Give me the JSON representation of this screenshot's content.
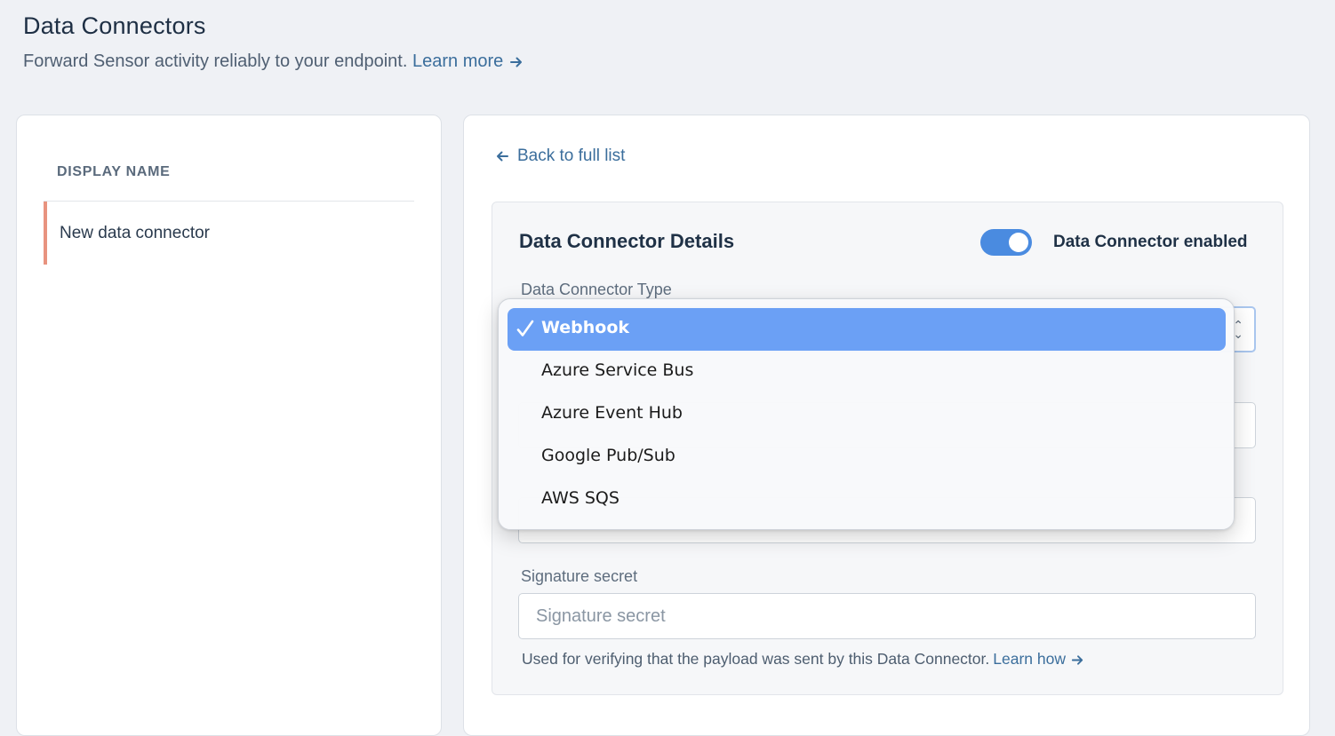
{
  "header": {
    "title": "Data Connectors",
    "subtitle": "Forward Sensor activity reliably to your endpoint.",
    "learn_more": "Learn more"
  },
  "list": {
    "column_header": "DISPLAY NAME",
    "items": [
      {
        "label": "New data connector"
      }
    ]
  },
  "detail": {
    "back_link": "Back to full list",
    "card_title": "Data Connector Details",
    "enabled_label": "Data Connector enabled",
    "enabled": true,
    "type_label": "Data Connector Type",
    "signature_label": "Signature secret",
    "signature_placeholder": "Signature secret",
    "helper_text": "Used for verifying that the payload was sent by this Data Connector.",
    "helper_link": "Learn how"
  },
  "dropdown": {
    "selected": "Webhook",
    "options": [
      {
        "label": "Webhook"
      },
      {
        "label": "Azure Service Bus"
      },
      {
        "label": "Azure Event Hub"
      },
      {
        "label": "Google Pub/Sub"
      },
      {
        "label": "AWS SQS"
      }
    ]
  },
  "icons": {
    "back": "arrow-left-icon",
    "learn_more": "arrow-right-icon",
    "check": "check-icon",
    "caret": "chevron-up-down-icon"
  },
  "colors": {
    "accent": "#4a8be0",
    "selection": "#6ba0f5",
    "list_marker": "#e8937f",
    "link": "#3b6e9c"
  }
}
